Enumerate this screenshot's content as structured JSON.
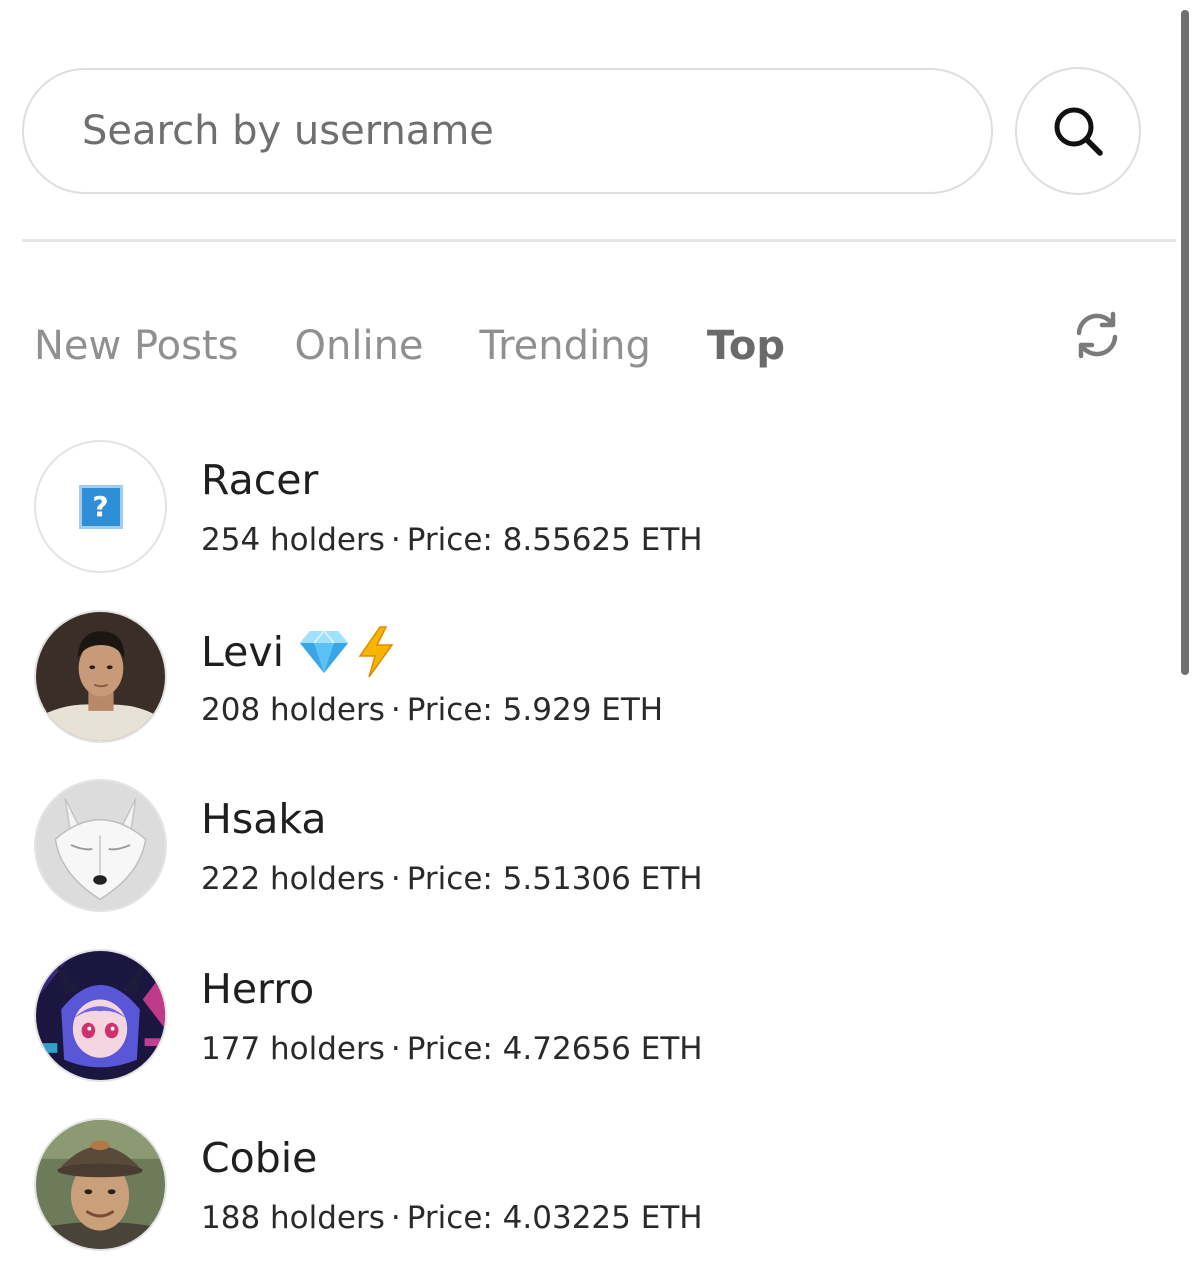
{
  "search": {
    "placeholder": "Search by username",
    "button_icon": "search-icon"
  },
  "tabs": [
    {
      "label": "New Posts",
      "active": false
    },
    {
      "label": "Online",
      "active": false
    },
    {
      "label": "Trending",
      "active": false
    },
    {
      "label": "Top",
      "active": true
    }
  ],
  "refresh_icon": "refresh-icon",
  "users": [
    {
      "name": "Racer",
      "badges": [],
      "holders": "254 holders",
      "separator": "·",
      "price": "Price: 8.55625 ETH",
      "avatar": "placeholder-question-icon"
    },
    {
      "name": "Levi",
      "badges": [
        "gem-icon",
        "lightning-icon"
      ],
      "holders": "208 holders",
      "separator": "·",
      "price": "Price: 5.929 ETH",
      "avatar": "profile-photo"
    },
    {
      "name": "Hsaka",
      "badges": [],
      "holders": "222 holders",
      "separator": "·",
      "price": "Price: 5.51306 ETH",
      "avatar": "white-wolf-image"
    },
    {
      "name": "Herro",
      "badges": [],
      "holders": "177 holders",
      "separator": "·",
      "price": "Price: 4.72656 ETH",
      "avatar": "anime-character-image"
    },
    {
      "name": "Cobie",
      "badges": [],
      "holders": "188 holders",
      "separator": "·",
      "price": "Price: 4.03225 ETH",
      "avatar": "profile-photo"
    }
  ]
}
